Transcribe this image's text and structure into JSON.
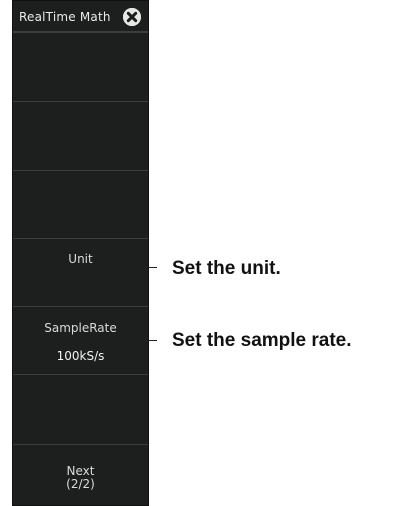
{
  "panel": {
    "title": "RealTime Math",
    "close_icon": "close-circle-icon"
  },
  "softkeys": [
    {
      "label": "",
      "value": ""
    },
    {
      "label": "",
      "value": ""
    },
    {
      "label": "",
      "value": ""
    },
    {
      "label": "Unit",
      "value": ""
    },
    {
      "label": "SampleRate",
      "value": "100kS/s"
    },
    {
      "label": "",
      "value": ""
    },
    {
      "label": "Next\n(2/2)",
      "value": ""
    }
  ],
  "callouts": {
    "unit": "Set the unit.",
    "sample_rate": "Set the sample rate."
  },
  "colors": {
    "panel_bg": "#1c1f1d",
    "divider": "#3a3f3b",
    "text": "#d8dcd8"
  }
}
